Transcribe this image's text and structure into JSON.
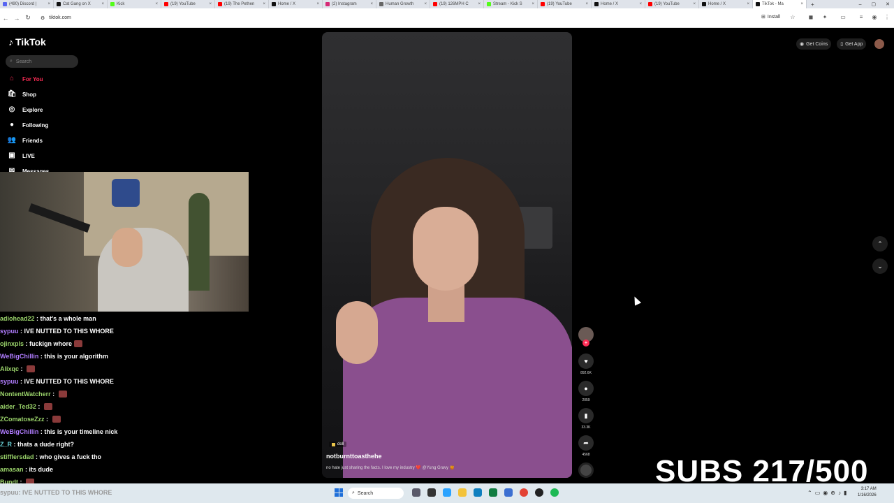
{
  "browser": {
    "tabs": [
      {
        "label": "(490) Discord |",
        "color": "#5865f2"
      },
      {
        "label": "Cat Gang on X",
        "color": "#111111"
      },
      {
        "label": "Kick",
        "color": "#53fc18"
      },
      {
        "label": "(19) YouTube",
        "color": "#ff0000"
      },
      {
        "label": "(19) The Pethen",
        "color": "#ff0000"
      },
      {
        "label": "Home / X",
        "color": "#111111"
      },
      {
        "label": "(2) Instagram",
        "color": "#d62976"
      },
      {
        "label": "Human Growth",
        "color": "#666666"
      },
      {
        "label": "(19) 126MPH C",
        "color": "#ff0000"
      },
      {
        "label": "Stream - Kick S",
        "color": "#53fc18"
      },
      {
        "label": "(19) YouTube",
        "color": "#ff0000"
      },
      {
        "label": "Home / X",
        "color": "#111111"
      },
      {
        "label": "(19) YouTube",
        "color": "#ff0000"
      },
      {
        "label": "Home / X",
        "color": "#111111"
      },
      {
        "label": "TikTok - Ma",
        "color": "#111111"
      }
    ],
    "url": "tiktok.com",
    "install_label": "Install"
  },
  "tiktok": {
    "logo": "TikTok",
    "search_placeholder": "Search",
    "nav": [
      {
        "label": "For You",
        "icon": "home-icon",
        "glyph": "⌂",
        "active": true
      },
      {
        "label": "Shop",
        "icon": "shop-icon",
        "glyph": "🛍"
      },
      {
        "label": "Explore",
        "icon": "compass-icon",
        "glyph": "◎"
      },
      {
        "label": "Following",
        "icon": "following-icon",
        "glyph": "●"
      },
      {
        "label": "Friends",
        "icon": "friends-icon",
        "glyph": "👥"
      },
      {
        "label": "LIVE",
        "icon": "live-icon",
        "glyph": "▣"
      },
      {
        "label": "Messages",
        "icon": "messages-icon",
        "glyph": "✉"
      }
    ],
    "get_coins": "Get Coins",
    "get_app": "Get App",
    "video": {
      "tag": "doll",
      "username": "notburnttoasthehe",
      "caption": "no hate just sharing the facts. I love my industry ❤️ @Yung Gravy 🍯"
    },
    "actions": {
      "likes": "892.6K",
      "comments": "2059",
      "saves": "33.3K",
      "shares": "4568"
    }
  },
  "chat": [
    {
      "user": "adiohead22",
      "msg": "that's a whole man",
      "cls": ""
    },
    {
      "user": "sypuu",
      "msg": "IVE NUTTED TO THIS WHORE",
      "cls": "p"
    },
    {
      "user": "ojinxpls",
      "msg": "fuckign whore",
      "cls": "",
      "emote": true
    },
    {
      "user": "WeBigChillin",
      "msg": "this is your algorithm",
      "cls": "p"
    },
    {
      "user": "Alixqc",
      "msg": "",
      "cls": "",
      "emote": true
    },
    {
      "user": "sypuu",
      "msg": "IVE NUTTED TO THIS WHORE",
      "cls": "p"
    },
    {
      "user": "NontentWatcherr",
      "msg": "",
      "cls": "",
      "emote": true
    },
    {
      "user": "aider_Ted32",
      "msg": "",
      "cls": "",
      "emote": true
    },
    {
      "user": "ZComatoseZzz",
      "msg": "",
      "cls": "",
      "emote": true
    },
    {
      "user": "WeBigChillin",
      "msg": "this is your timeline nick",
      "cls": "p"
    },
    {
      "user": "Z_R",
      "msg": "thats a dude right?",
      "cls": "c"
    },
    {
      "user": "stifflersdad",
      "msg": "who gives a fuck tho",
      "cls": ""
    },
    {
      "user": "amasan",
      "msg": "its dude",
      "cls": ""
    },
    {
      "user": "Bundt",
      "msg": "",
      "cls": "",
      "emote": true
    }
  ],
  "subs": "SUBS 217/500",
  "taskbar": {
    "ghost_text": "sypuu: IVE NUTTED TO THIS WHORE",
    "search_label": "Search",
    "time": "3:17 AM",
    "date": "1/16/2026"
  }
}
